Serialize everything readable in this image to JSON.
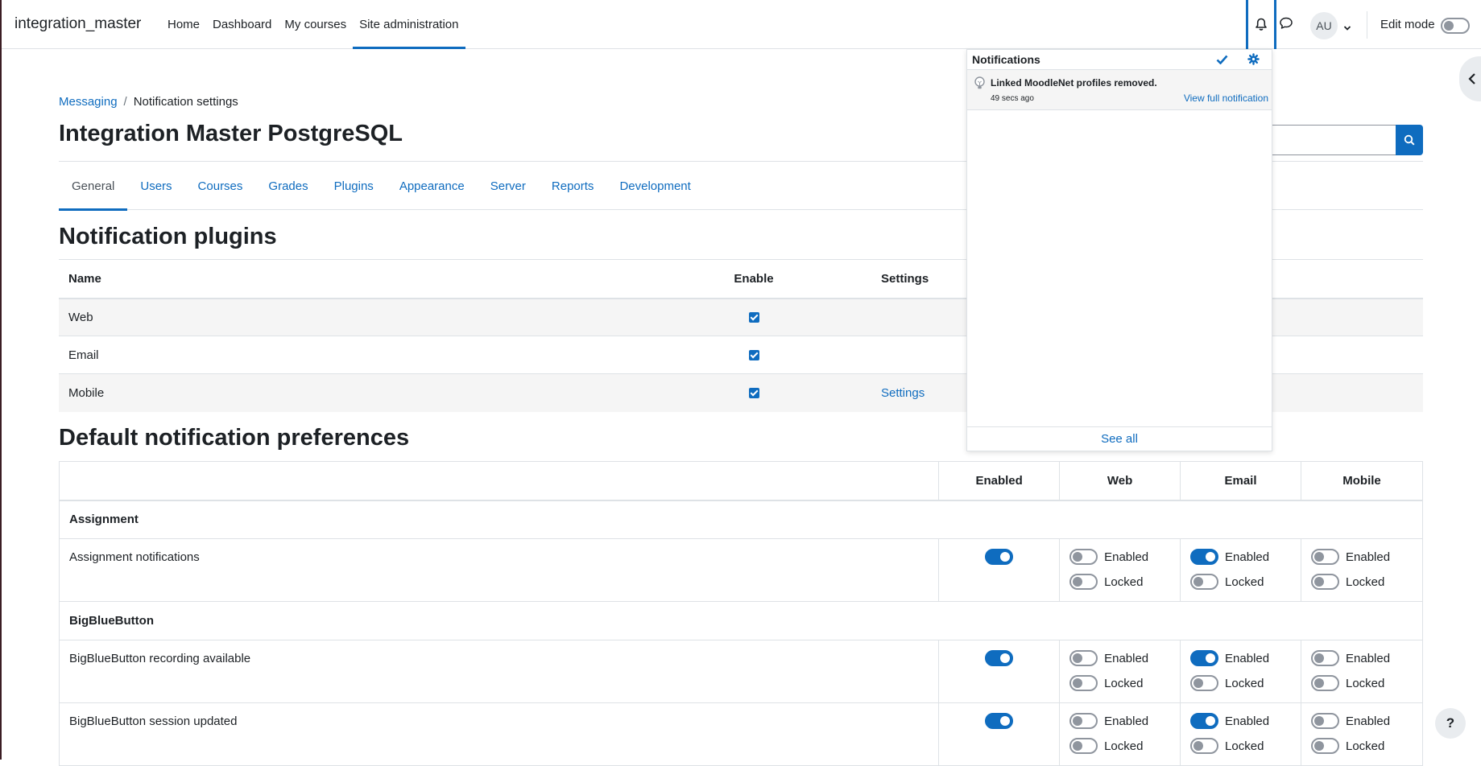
{
  "brand": "integration_master",
  "primary_nav": [
    {
      "label": "Home"
    },
    {
      "label": "Dashboard"
    },
    {
      "label": "My courses"
    },
    {
      "label": "Site administration"
    }
  ],
  "user": {
    "initials": "AU"
  },
  "edit_mode": {
    "label": "Edit mode",
    "on": false
  },
  "breadcrumb": {
    "messaging": "Messaging",
    "current": "Notification settings"
  },
  "page_title": "Integration Master PostgreSQL",
  "tabs": [
    {
      "label": "General"
    },
    {
      "label": "Users"
    },
    {
      "label": "Courses"
    },
    {
      "label": "Grades"
    },
    {
      "label": "Plugins"
    },
    {
      "label": "Appearance"
    },
    {
      "label": "Server"
    },
    {
      "label": "Reports"
    },
    {
      "label": "Development"
    }
  ],
  "plugins": {
    "heading": "Notification plugins",
    "headers": {
      "name": "Name",
      "enable": "Enable",
      "settings": "Settings"
    },
    "rows": [
      {
        "name": "Web",
        "enabled": true,
        "settings": ""
      },
      {
        "name": "Email",
        "enabled": true,
        "settings": ""
      },
      {
        "name": "Mobile",
        "enabled": true,
        "settings": "Settings"
      }
    ]
  },
  "prefs": {
    "heading": "Default notification preferences",
    "headers": {
      "enabled": "Enabled",
      "web": "Web",
      "email": "Email",
      "mobile": "Mobile"
    },
    "labels": {
      "enabled": "Enabled",
      "locked": "Locked"
    },
    "sections": [
      {
        "title": "Assignment",
        "items": [
          {
            "name": "Assignment notifications",
            "enabled": true,
            "web": {
              "enabled": false,
              "locked": false
            },
            "email": {
              "enabled": true,
              "locked": false
            },
            "mobile": {
              "enabled": false,
              "locked": false
            }
          }
        ]
      },
      {
        "title": "BigBlueButton",
        "items": [
          {
            "name": "BigBlueButton recording available",
            "enabled": true,
            "web": {
              "enabled": false,
              "locked": false
            },
            "email": {
              "enabled": true,
              "locked": false
            },
            "mobile": {
              "enabled": false,
              "locked": false
            }
          },
          {
            "name": "BigBlueButton session updated",
            "enabled": true,
            "web": {
              "enabled": false,
              "locked": false
            },
            "email": {
              "enabled": true,
              "locked": false
            },
            "mobile": {
              "enabled": false,
              "locked": false
            }
          }
        ]
      }
    ]
  },
  "notifications": {
    "title": "Notifications",
    "items": [
      {
        "text": "Linked MoodleNet profiles removed.",
        "time": "49 secs ago",
        "link": "View full notification"
      }
    ],
    "see_all": "See all"
  },
  "help": "?",
  "colors": {
    "accent": "#0f6cbf",
    "text": "#1d2125",
    "border": "#dee2e6",
    "stripe": "#f5f5f5"
  }
}
